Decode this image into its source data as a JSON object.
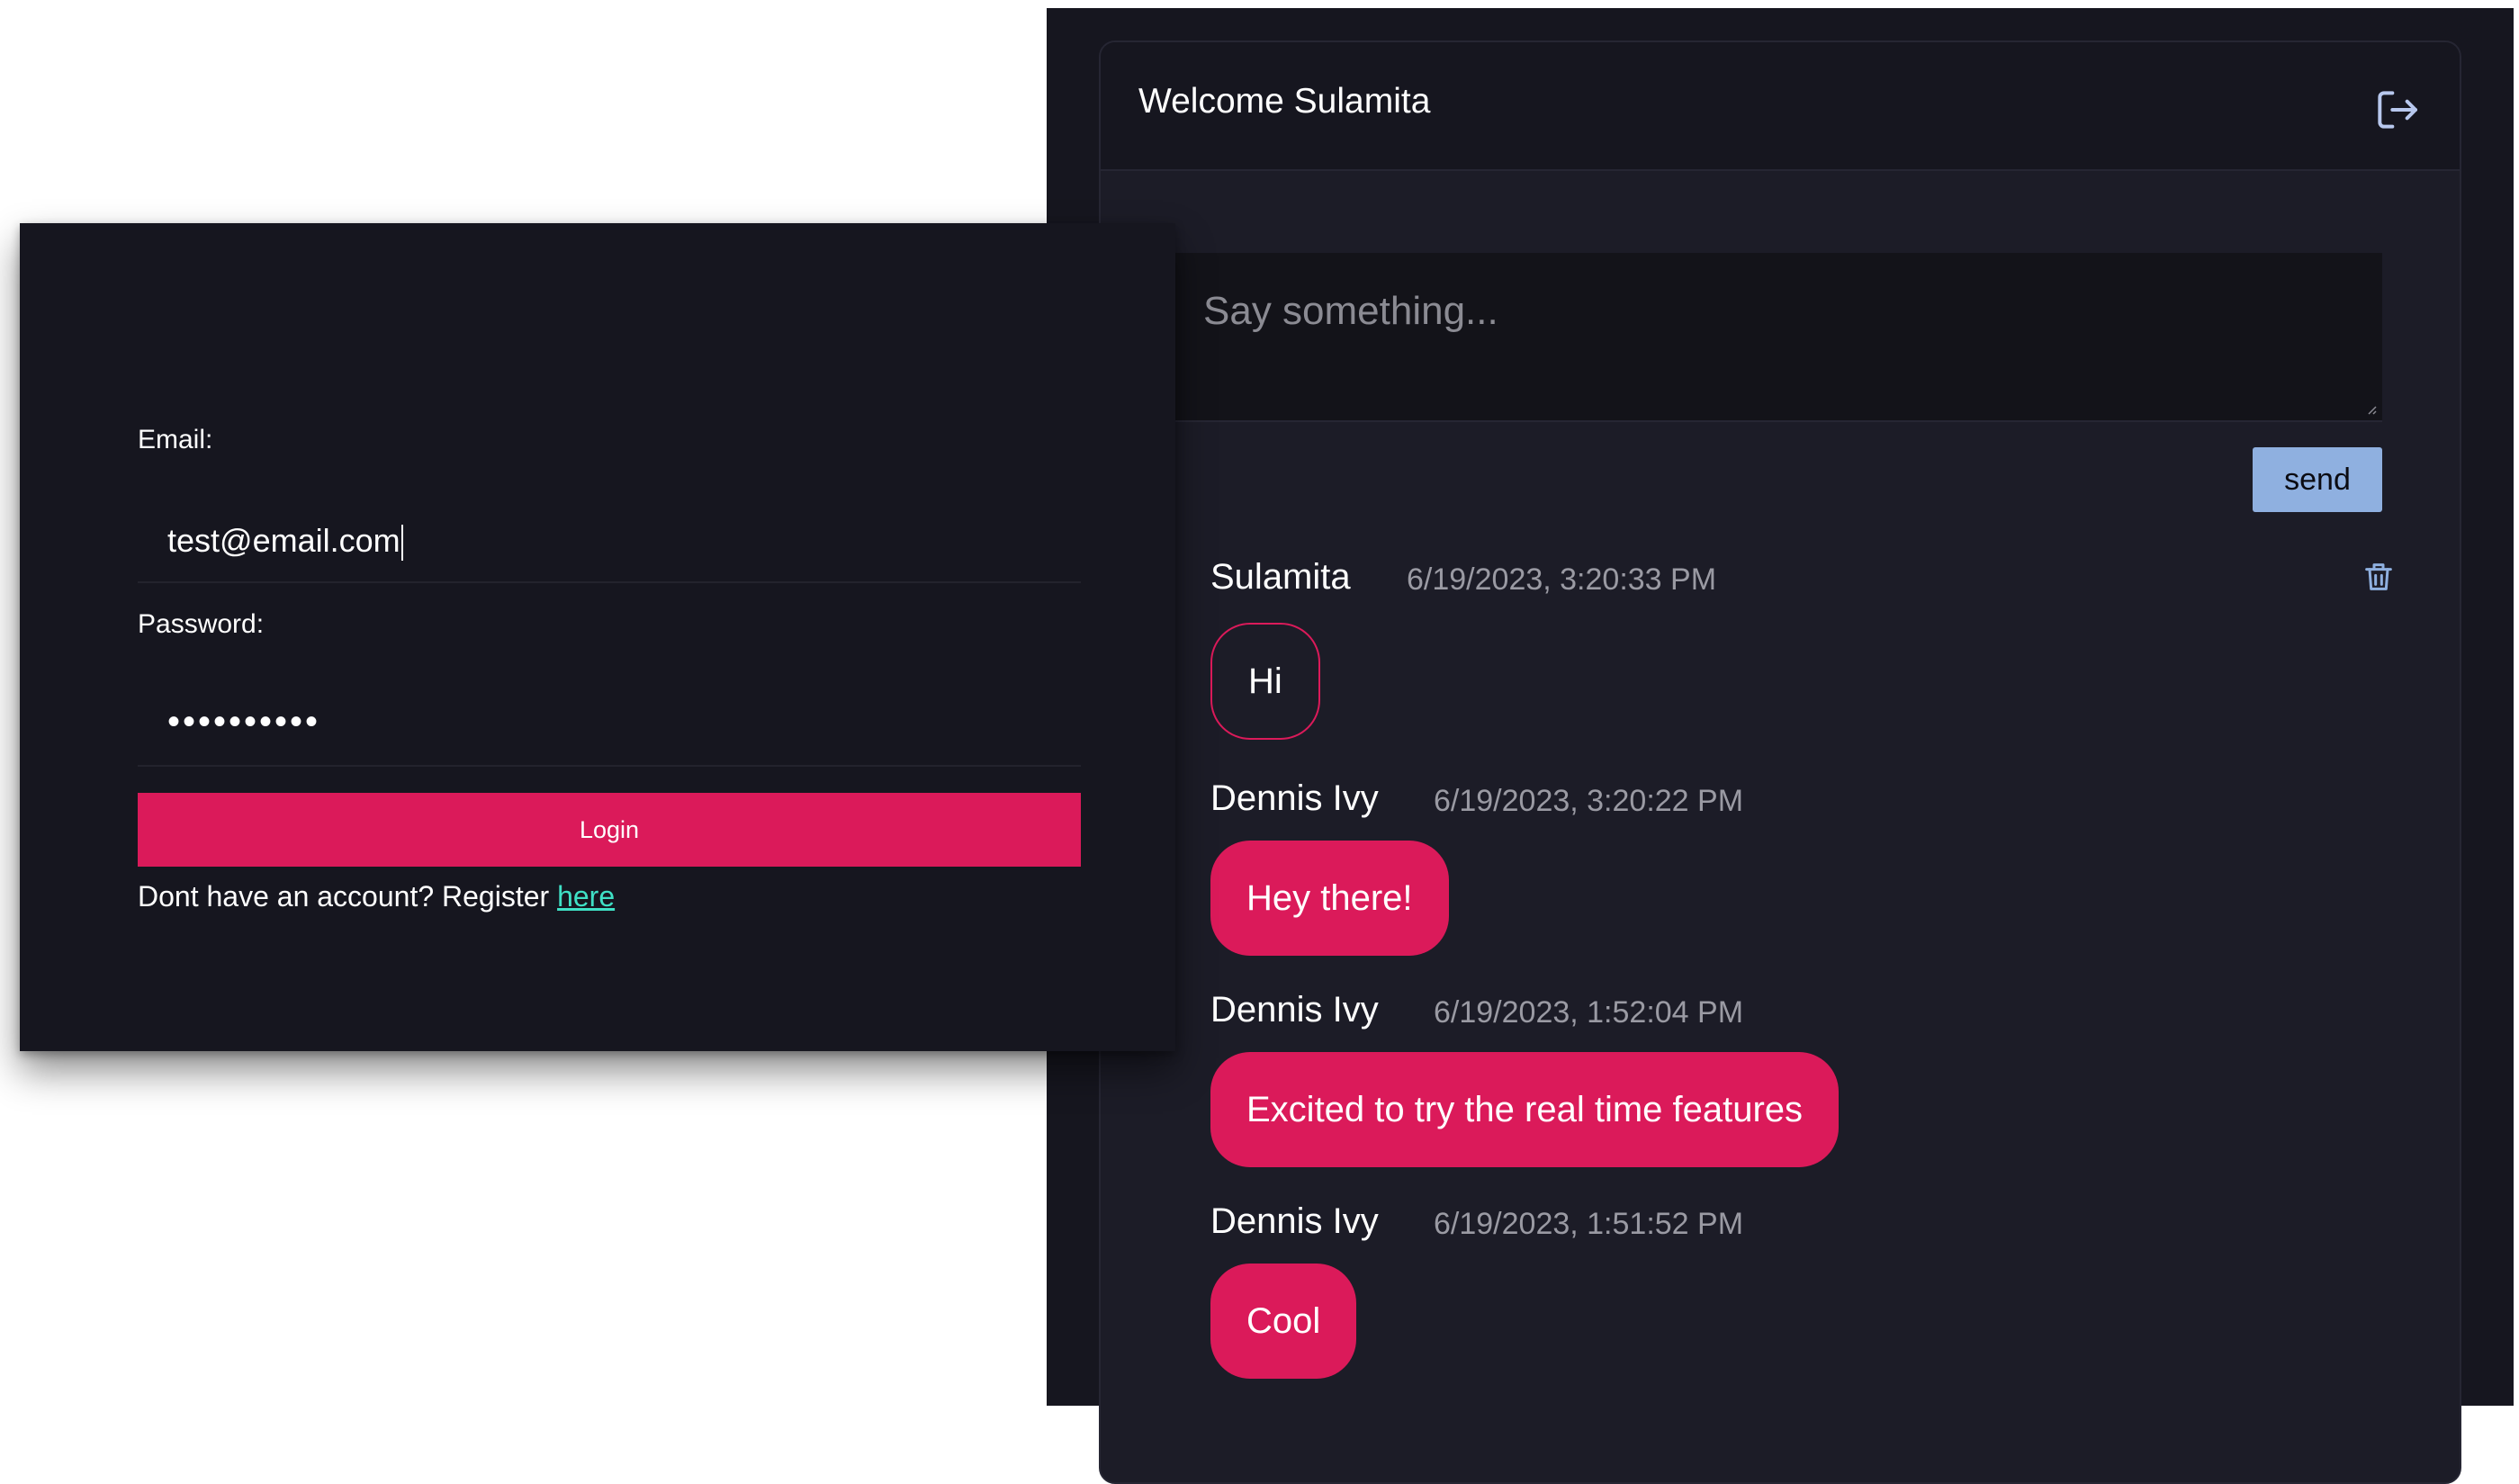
{
  "chat": {
    "title": "Welcome Sulamita",
    "composer_placeholder": "Say something...",
    "send_label": "send",
    "messages": [
      {
        "author": "Sulamita",
        "time": "6/19/2023, 3:20:33 PM",
        "body": "Hi",
        "own": true
      },
      {
        "author": "Dennis Ivy",
        "time": "6/19/2023, 3:20:22 PM",
        "body": "Hey there!",
        "own": false
      },
      {
        "author": "Dennis Ivy",
        "time": "6/19/2023, 1:52:04 PM",
        "body": "Excited to try the real time features",
        "own": false
      },
      {
        "author": "Dennis Ivy",
        "time": "6/19/2023, 1:51:52 PM",
        "body": "Cool",
        "own": false
      }
    ]
  },
  "login": {
    "email_label": "Email:",
    "email_value": "test@email.com",
    "password_label": "Password:",
    "password_masked": "••••••••••",
    "login_label": "Login",
    "register_prompt": "Dont have an account? Register ",
    "register_link": "here"
  },
  "colors": {
    "accent": "#db1a5a",
    "send_button": "#8fb0e0",
    "link": "#3fe0c5",
    "panel_bg": "#16161f"
  },
  "icons": {
    "logout": "logout-icon",
    "delete": "trash-icon"
  }
}
